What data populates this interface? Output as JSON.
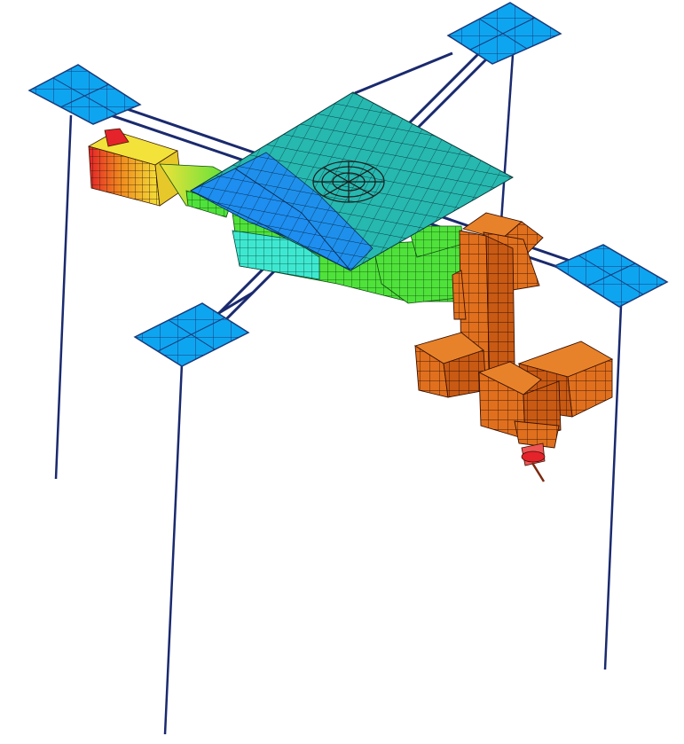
{
  "scene": {
    "description_visible_text": "",
    "colors": {
      "background": "#ffffff",
      "wire": "#1a2a6e",
      "solar_panel": "#0ea5f0",
      "solar_panel_grid": "#1a3a7a",
      "deck_teal": "#27b8b0",
      "deck_blue": "#1e8ef0",
      "mesh_line": "#0a2a2a",
      "arm_orange": "#e0701e",
      "arm_yellow": "#f2e23a",
      "arm_red": "#e5232a",
      "arm_green": "#4fe23a",
      "arm_cyan": "#3ee8d0",
      "hub_circle": "#1a1a1a"
    },
    "contour_scale": [
      "#e5232a",
      "#f08a1e",
      "#f2e23a",
      "#4fe23a",
      "#3ee8d0",
      "#1e8ef0"
    ]
  }
}
